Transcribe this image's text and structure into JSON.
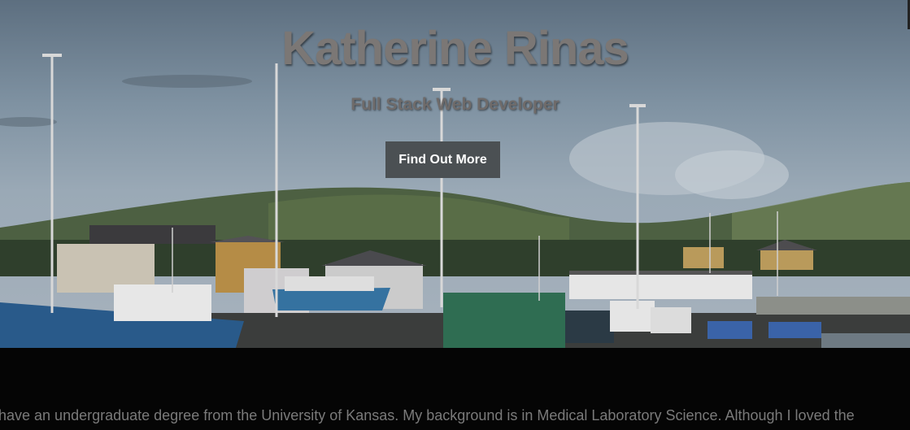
{
  "hero": {
    "title": "Katherine Rinas",
    "subtitle": "Full Stack Web Developer",
    "cta_label": "Find Out More"
  },
  "about": {
    "text": "have an undergraduate degree from the University of Kansas. My background is in Medical Laboratory Science. Although I loved the"
  },
  "colors": {
    "button_bg": "#4b5053",
    "band_bg": "#050505",
    "title_color": "#7b7775"
  }
}
